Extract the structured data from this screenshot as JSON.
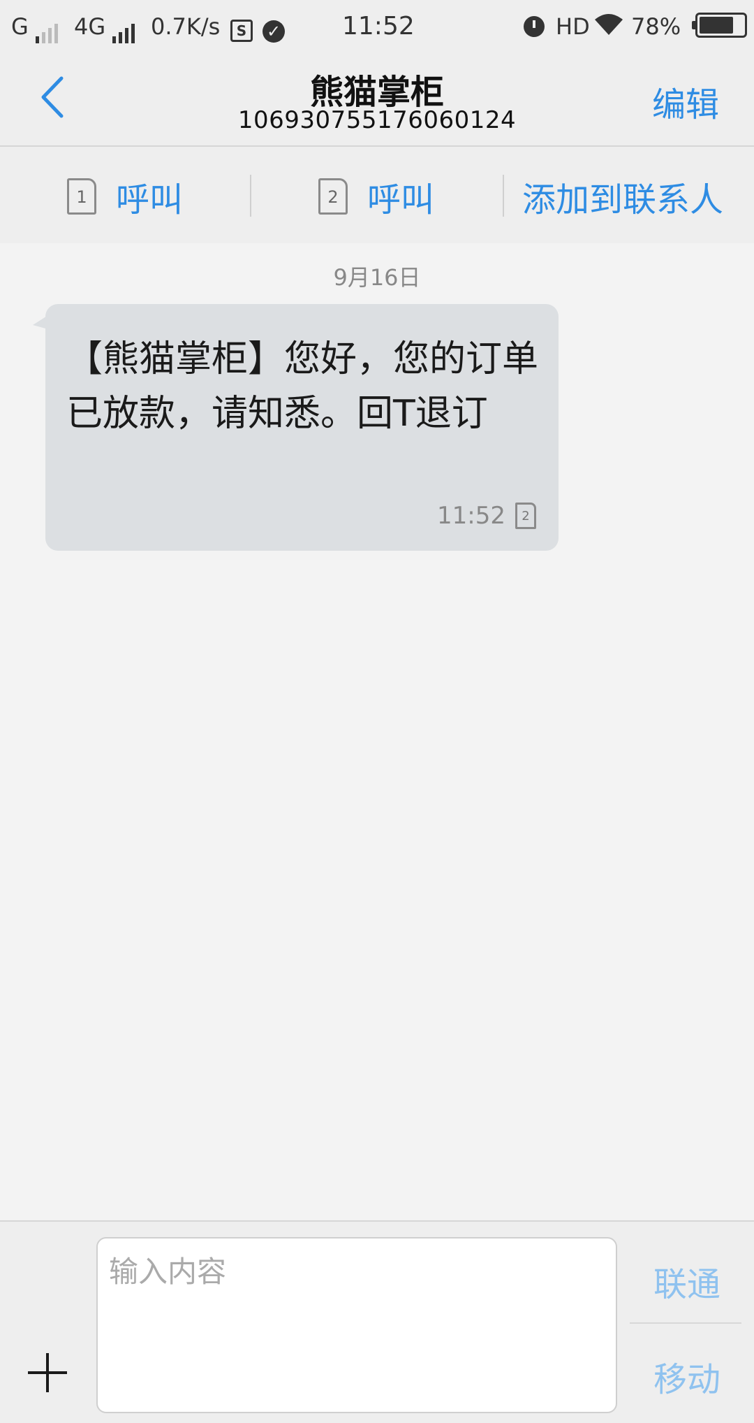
{
  "status_bar": {
    "carrier1": "G",
    "carrier2": "4G",
    "speed": "0.7K/s",
    "app_badge": "S",
    "time": "11:52",
    "hd": "HD",
    "battery": "78%"
  },
  "header": {
    "back_icon": "chevron-left-icon",
    "title": "熊猫掌柜",
    "number": "1069307551760601​24",
    "edit_label": "编辑"
  },
  "actions": {
    "call1_sim": "1",
    "call1_label": "呼叫",
    "call2_sim": "2",
    "call2_label": "呼叫",
    "add_contact": "添加到联系人"
  },
  "conversation": {
    "date": "9月16日",
    "messages": [
      {
        "text": "【熊猫掌柜】您好，您的订单已放款，请知悉。回T退订",
        "time": "11:52",
        "sim": "2"
      }
    ]
  },
  "composer": {
    "placeholder": "输入内容",
    "sim_unicom": "联通",
    "sim_mobile": "移动"
  },
  "colors": {
    "accent": "#2e8ce3",
    "accent_disabled": "#8fc2ef",
    "bubble": "#dcdfe2",
    "background": "#f3f3f3"
  }
}
